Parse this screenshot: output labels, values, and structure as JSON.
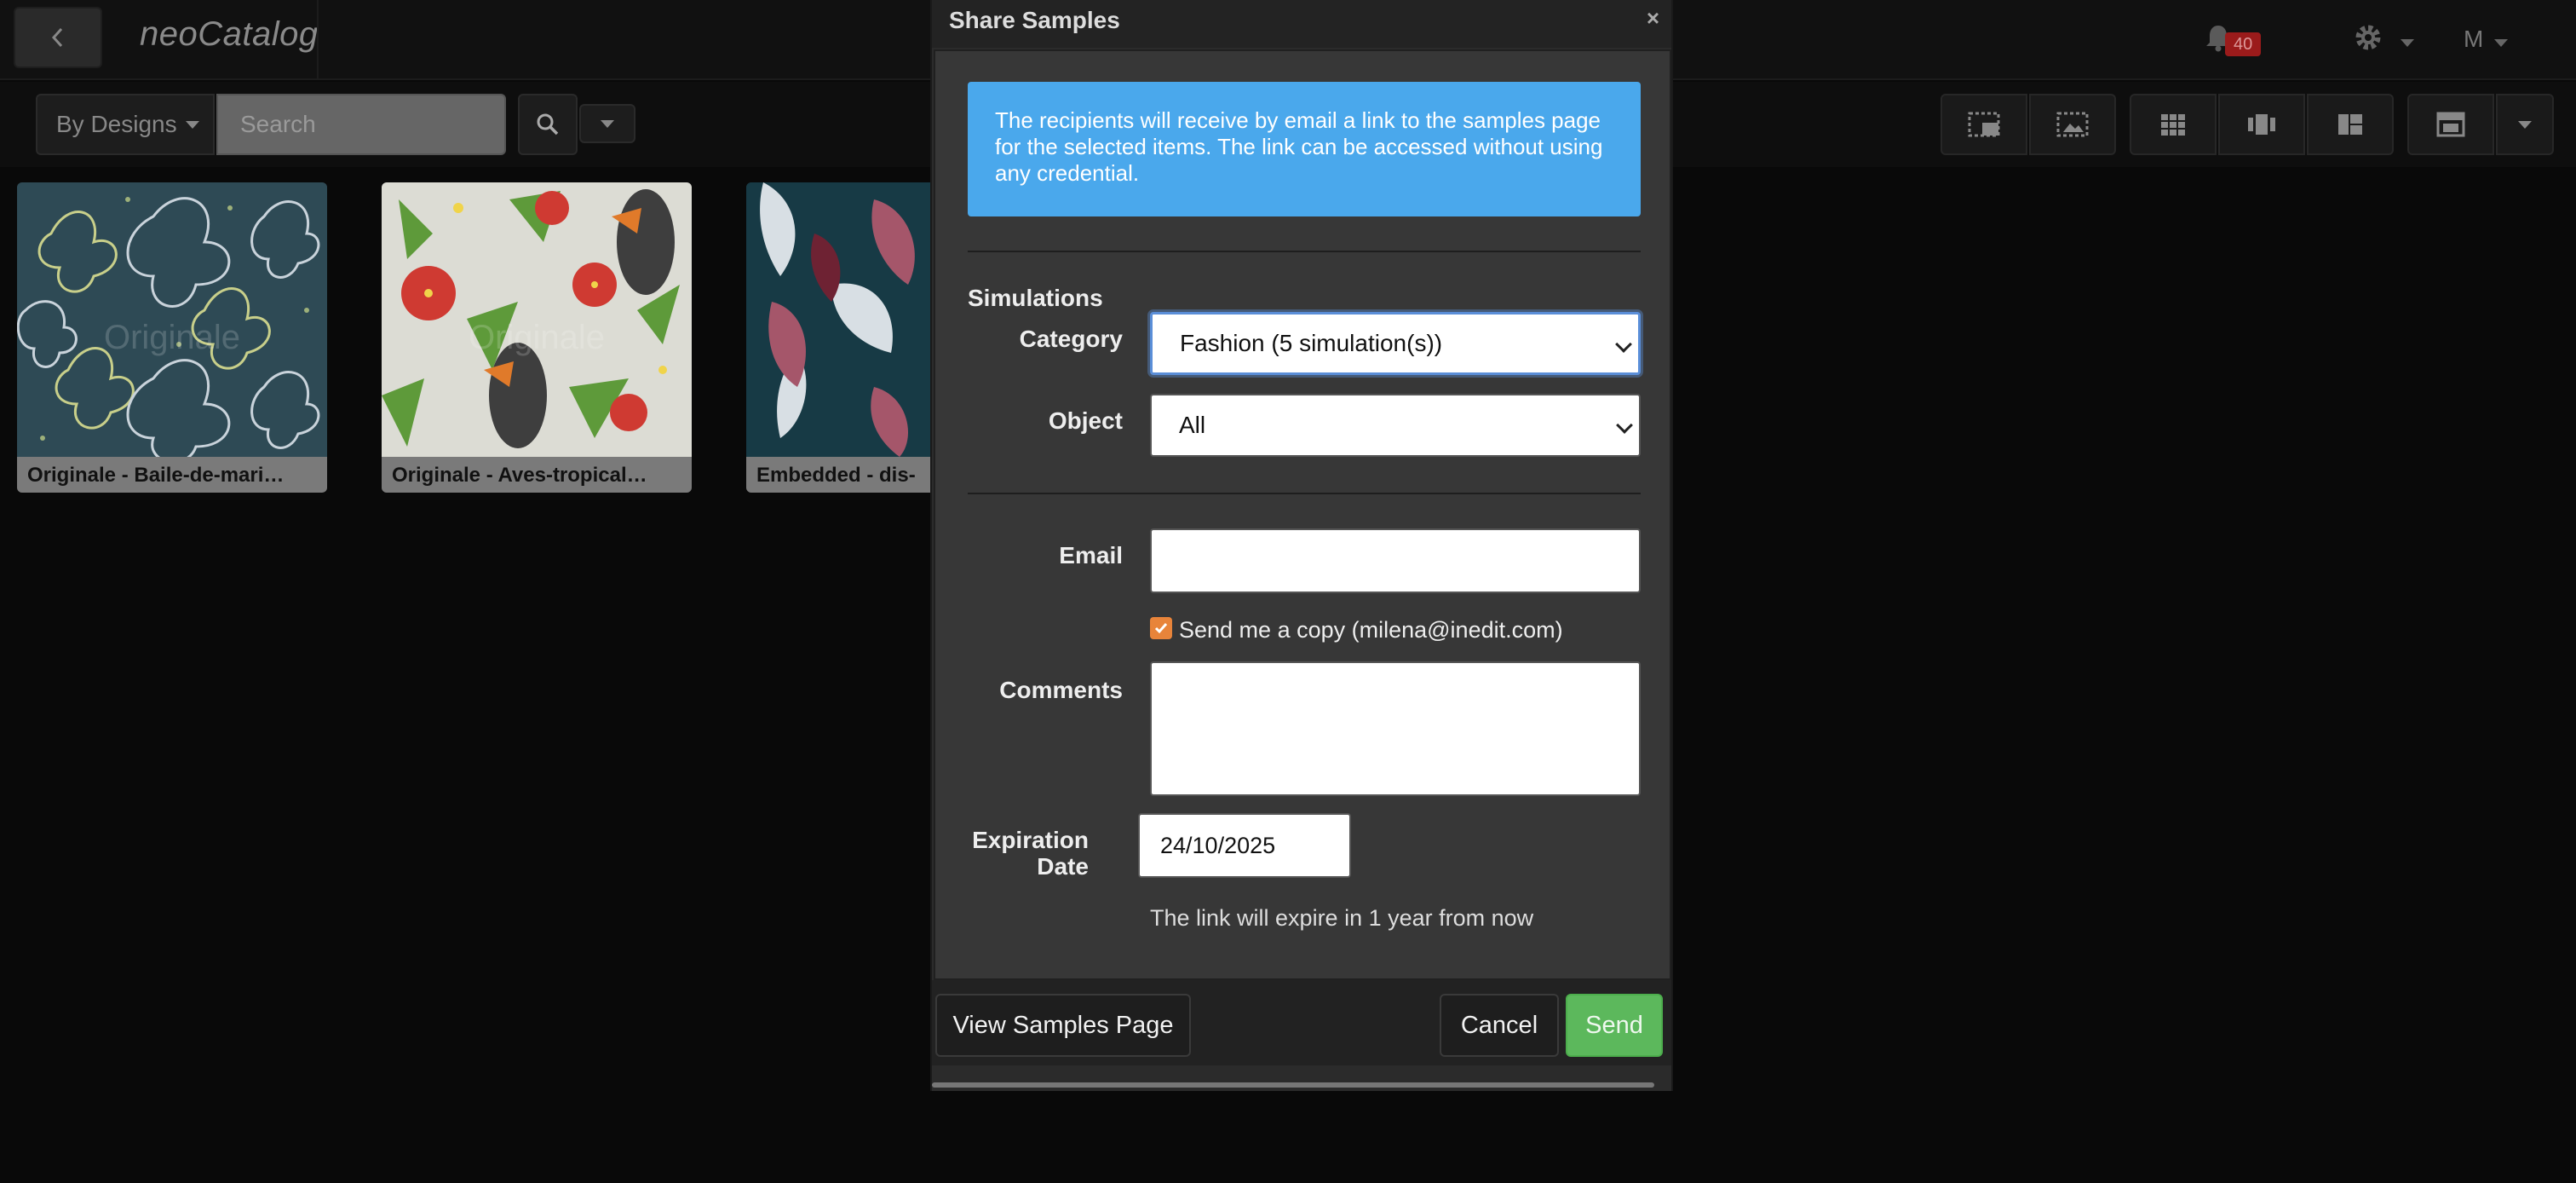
{
  "navbar": {
    "brand": "neoCatalog",
    "notification_count": "40",
    "user_initial": "M"
  },
  "toolbar": {
    "group_by_label": "By Designs",
    "search_placeholder": "Search",
    "view_icons": [
      "select-area-icon",
      "select-image-icon",
      "grid-icon",
      "carousel-icon",
      "mosaic-icon",
      "panel-icon"
    ]
  },
  "gallery": {
    "items": [
      {
        "label": "Originale - Baile-de-mari…",
        "watermark": "Originale"
      },
      {
        "label": "Originale - Aves-tropical…",
        "watermark": "Originale"
      },
      {
        "label": "Embedded - dis-"
      }
    ]
  },
  "modal": {
    "title": "Share Samples",
    "close": "×",
    "info": "The recipients will receive by email a link to the samples page for the selected items. The link can be accessed without using any credential.",
    "simulations_label": "Simulations",
    "category_label": "Category",
    "category_value": "Fashion (5 simulation(s))",
    "object_label": "Object",
    "object_value": "All",
    "email_label": "Email",
    "email_value": "",
    "send_copy_label": "Send me a copy (milena@inedit.com)",
    "send_copy_checked": true,
    "comments_label": "Comments",
    "comments_value": "",
    "expiration_label_1": "Expiration",
    "expiration_label_2": "Date",
    "expiration_value": "24/10/2025",
    "expire_note": "The link will expire in 1 year from now",
    "view_samples_label": "View Samples Page",
    "cancel_label": "Cancel",
    "send_label": "Send"
  },
  "colors": {
    "info_blue": "#4aa8ec",
    "send_green": "#5cb85c",
    "checkbox_orange": "#e8843a",
    "badge_red": "#9b1b1b"
  }
}
